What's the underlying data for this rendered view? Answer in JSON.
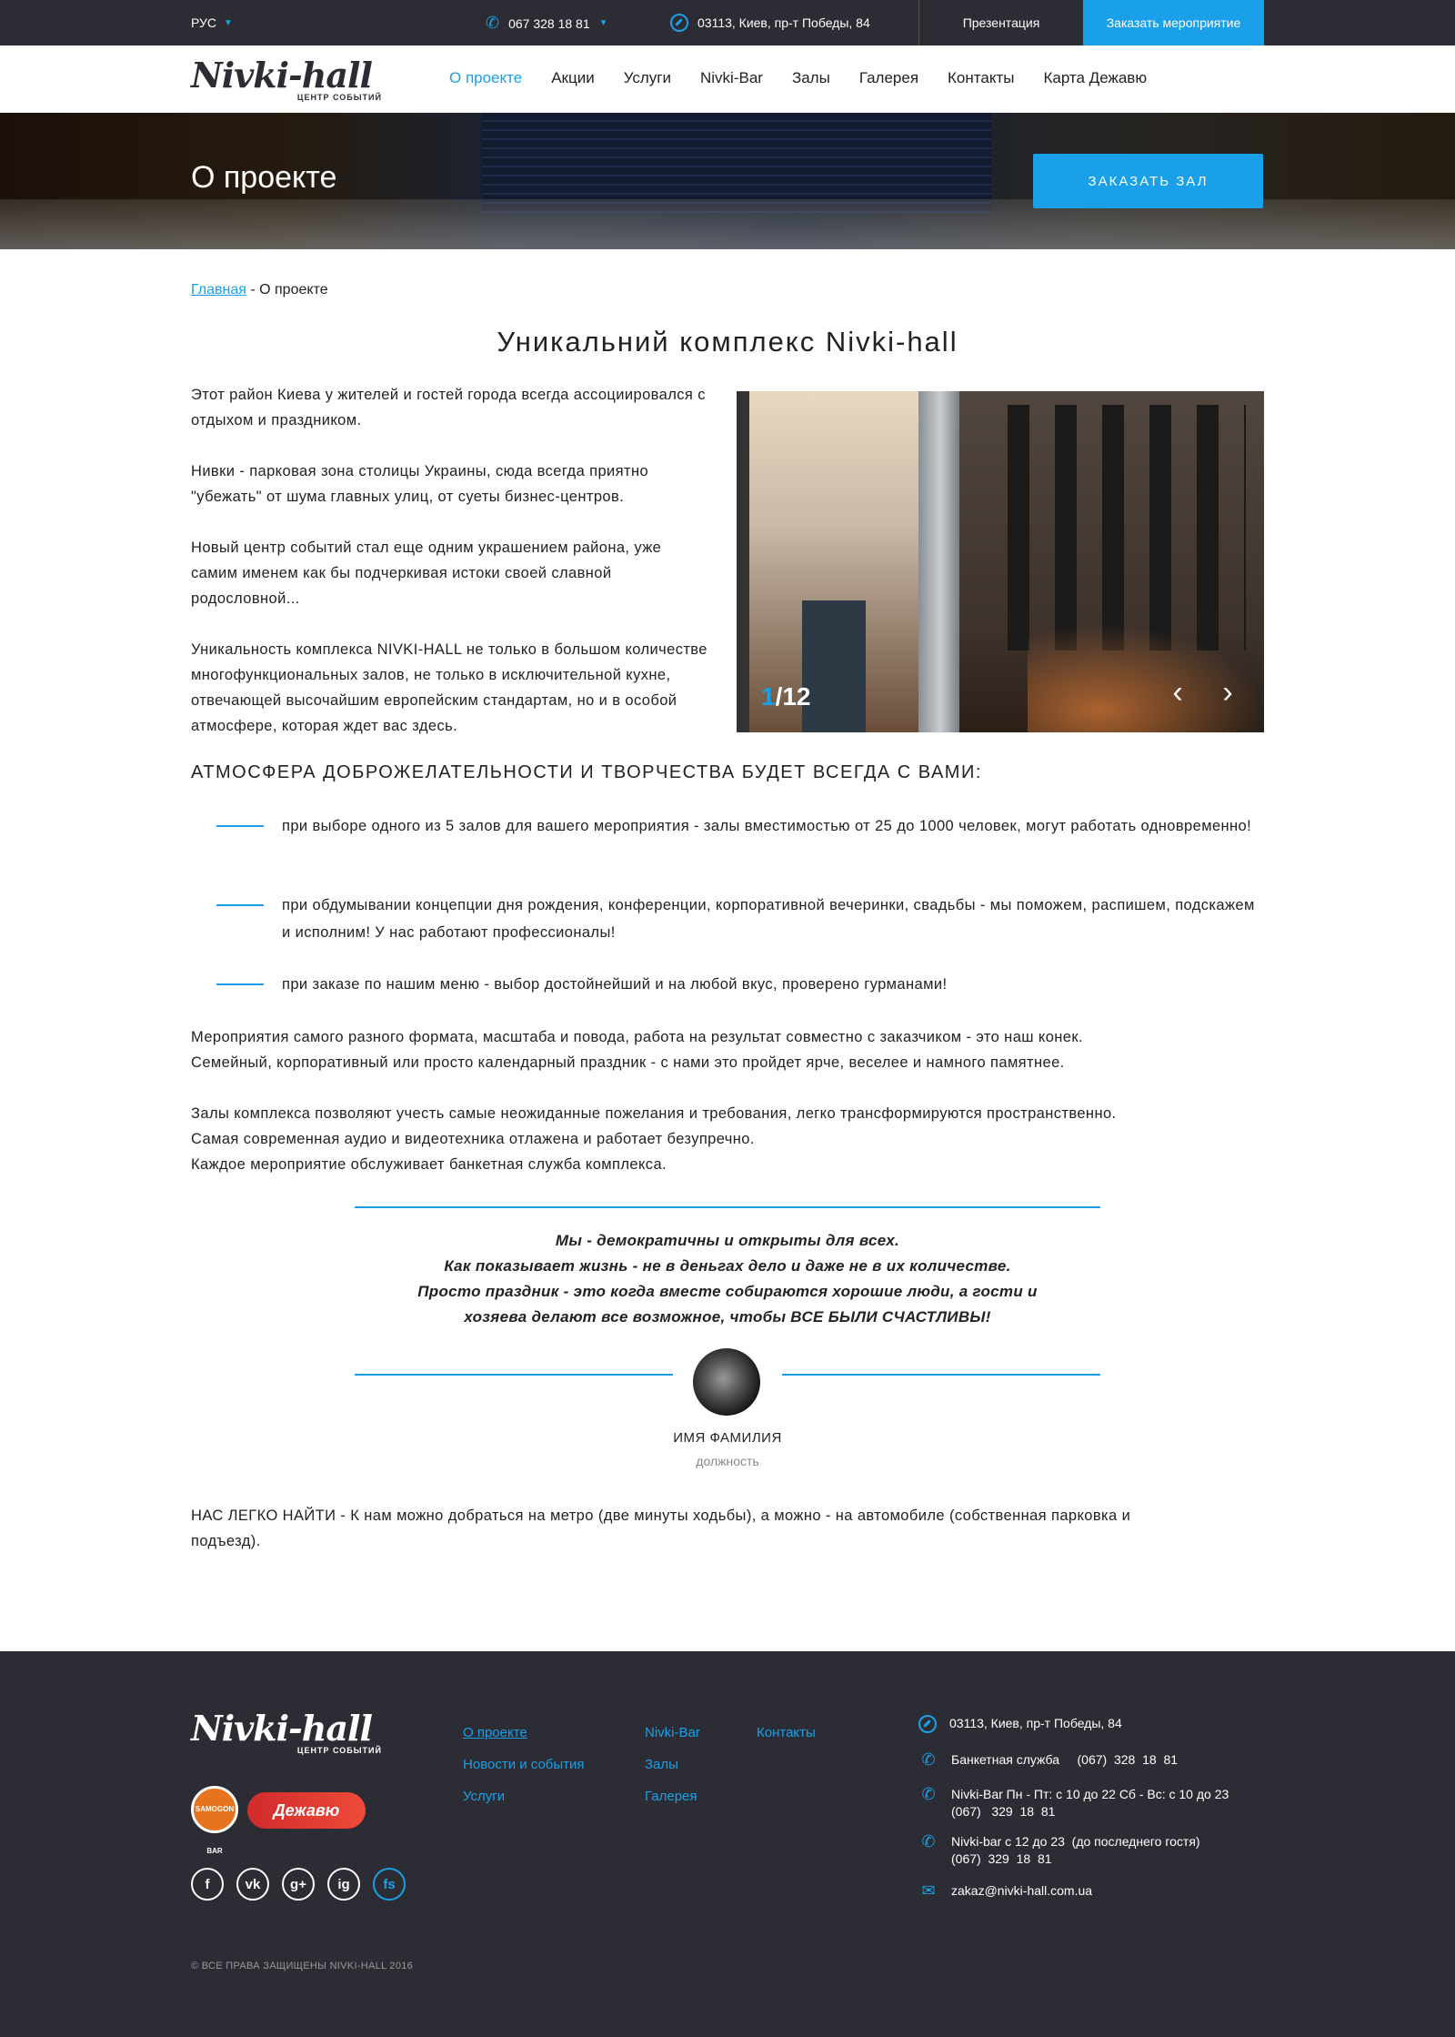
{
  "topbar": {
    "lang": "РУС",
    "phone": "067 328 18 81",
    "address": "03113, Киев, пр-т Победы, 84",
    "presentation": "Презентация",
    "order_event": "Заказать мероприятие"
  },
  "logo": {
    "title": "Nivki-hall",
    "subtitle": "ЦЕНТР СОБЫТИЙ"
  },
  "menu": [
    "О проекте",
    "Акции",
    "Услуги",
    "Nivki-Bar",
    "Залы",
    "Галерея",
    "Контакты",
    "Карта Дежавю"
  ],
  "hero": {
    "title": "О проекте",
    "button": "ЗАКАЗАТЬ ЗАЛ"
  },
  "breadcrumb": {
    "home": "Главная",
    "sep": " - ",
    "current": "О проекте"
  },
  "heading": "Уникальний комплекс Nivki-hall",
  "intro": [
    "Этот район Киева у жителей и гостей города всегда ассоциировался с отдыхом и праздником.",
    "Нивки - парковая зона столицы Украины, сюда всегда приятно \"убежать\" от шума главных улиц, от суеты бизнес-центров.",
    "Новый центр событий стал еще одним украшением района, уже самим именем как бы подчеркивая истоки своей славной родословной...",
    "Уникальность комплекса NIVKI-HALL не только в большом количестве многофункциональных залов, не только в исключительной кухне, отвечающей высочайшим европейским стандартам, но и в особой атмосфере, которая ждет вас здесь."
  ],
  "slider": {
    "current": "1",
    "total": "/12"
  },
  "subheading": "АТМОСФЕРА ДОБРОЖЕЛАТЕЛЬНОСТИ И ТВОРЧЕСТВА БУДЕТ ВСЕГДА С ВАМИ:",
  "bullets": [
    "при выборе одного из 5 залов для вашего мероприятия - залы вместимостью от 25 до 1000 человек, могут работать одновременно!",
    "при обдумывании концепции дня рождения, конференции, корпоративной вечеринки, свадьбы - мы поможем, распишем, подскажем и исполним! У нас работают профессионалы!",
    "при заказе по нашим меню - выбор достойнейший и на любой вкус, проверено гурманами!"
  ],
  "para1": [
    "Мероприятия самого разного формата, масштаба и повода, работа на результат совместно с заказчиком - это наш конек.",
    "Семейный, корпоративный или просто календарный праздник - с нами это пройдет ярче, веселее и намного памятнее."
  ],
  "para2": [
    "Залы комплекса позволяют учесть самые неожиданные пожелания и требования, легко трансформируются пространственно.",
    "Самая современная аудио и видеотехника отлажена и работает безупречно.",
    "Каждое мероприятие обслуживает  банкетная служба комплекса."
  ],
  "quote": [
    "Мы - демократичны и открыты для всех.",
    "Как показывает жизнь - не в деньгах дело и даже не в их количестве.",
    "Просто праздник - это когда вместе собираются хорошие люди, а гости и",
    "хозяева делают все возможное, чтобы ВСЕ БЫЛИ СЧАСТЛИВЫ!"
  ],
  "author": {
    "name": "ИМЯ ФАМИЛИЯ",
    "position": "должность"
  },
  "find_us": [
    "НАС ЛЕГКО НАЙТИ - К нам можно добраться на метро (две минуты ходьбы), а можно - на автомобиле (собственная парковка и",
    "подъезд)."
  ],
  "footer": {
    "partners": [
      "SAMOGON BAR",
      "Дежавю"
    ],
    "social": [
      "f",
      "vk",
      "g+",
      "ig",
      "fs"
    ],
    "col1": [
      "О проекте",
      "Новости и события",
      "Услуги"
    ],
    "col2": [
      "Nivki-Bar",
      "Залы",
      "Галерея"
    ],
    "col3": [
      "Контакты"
    ],
    "address": "03113, Киев, пр-т Победы, 84",
    "banquet": "Банкетная служба     (067)  328  18  81",
    "bar1_line1": "Nivki-Bar Пн - Пт: с 10 до 22 Сб - Вс: с 10 до 23",
    "bar1_line2": "(067)   329  18  81",
    "bar2_line1": "Nivki-bar с 12 до 23  (до последнего гостя)",
    "bar2_line2": "(067)  329  18  81",
    "email": "zakaz@nivki-hall.com.ua",
    "copyright": "© ВСЕ ПРАВА ЗАЩИЩЕНЫ NIVKI-HALL 2016"
  },
  "colors": {
    "accent": "#1aa0e8",
    "dark": "#2c2c35"
  }
}
